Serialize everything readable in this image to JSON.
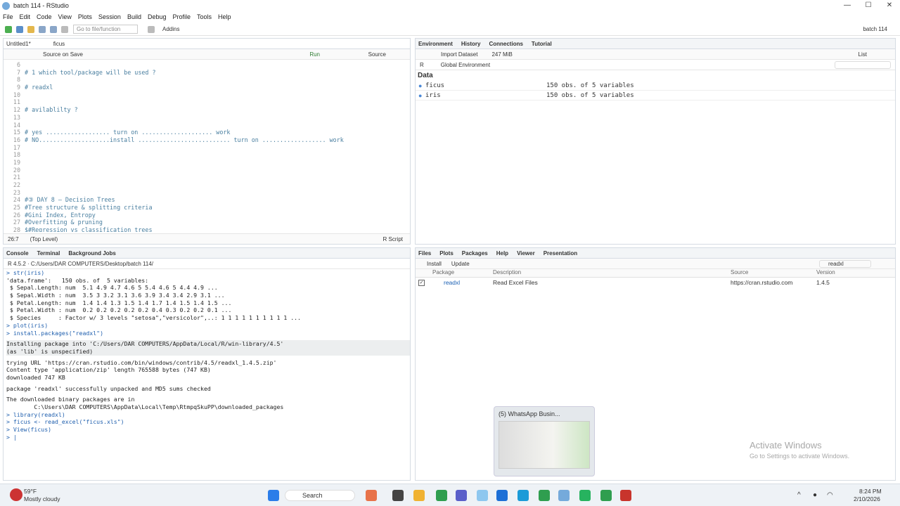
{
  "window": {
    "title": "batch 114 - RStudio",
    "controls": [
      "—",
      "☐",
      "✕"
    ]
  },
  "menu": [
    "File",
    "Edit",
    "Code",
    "View",
    "Plots",
    "Session",
    "Build",
    "Debug",
    "Profile",
    "Tools",
    "Help"
  ],
  "toolbar": {
    "goto_placeholder": "Go to file/function",
    "addins": "Addins",
    "project": "batch 114"
  },
  "editor": {
    "tabs": [
      "Untitled1*",
      "ficus"
    ],
    "source_on_save": "Source on Save",
    "run": "Run",
    "source": "Source",
    "lines": [
      {
        "n": "6",
        "t": ""
      },
      {
        "n": "7",
        "t": "# 1 which tool/package will be used ?"
      },
      {
        "n": "8",
        "t": ""
      },
      {
        "n": "9",
        "t": "# readxl"
      },
      {
        "n": "10",
        "t": ""
      },
      {
        "n": "11",
        "t": ""
      },
      {
        "n": "12",
        "t": "# avilablilty ?"
      },
      {
        "n": "13",
        "t": ""
      },
      {
        "n": "14",
        "t": ""
      },
      {
        "n": "15",
        "t": "# yes .................. turn on .................... work"
      },
      {
        "n": "16",
        "t": "# NO....................install .......................... turn on .................. work"
      },
      {
        "n": "17",
        "t": ""
      },
      {
        "n": "18",
        "t": ""
      },
      {
        "n": "19",
        "t": ""
      },
      {
        "n": "20",
        "t": ""
      },
      {
        "n": "21",
        "t": ""
      },
      {
        "n": "22",
        "t": ""
      },
      {
        "n": "23",
        "t": ""
      },
      {
        "n": "24",
        "t": "#③ DAY 8 – Decision Trees"
      },
      {
        "n": "25",
        "t": "#Tree structure & splitting criteria"
      },
      {
        "n": "26",
        "t": "#Gini Index, Entropy"
      },
      {
        "n": "27",
        "t": "#Overfitting & pruning"
      },
      {
        "n": "28",
        "t": "$#Regression vs classification trees"
      },
      {
        "n": "29",
        "t": "#Hands-on: Decision trees in R"
      }
    ],
    "status_pos": "26:7",
    "status_level": "(Top Level)",
    "status_type": "R Script"
  },
  "environment": {
    "tabs": [
      "Environment",
      "History",
      "Connections",
      "Tutorial"
    ],
    "import_dataset": "Import Dataset",
    "memory": "247 MiB",
    "list_label": "List",
    "lang": "R",
    "scope": "Global Environment",
    "section": "Data",
    "rows": [
      {
        "name": "ficus",
        "value": "150 obs. of 5 variables"
      },
      {
        "name": "iris",
        "value": "150 obs. of 5 variables"
      }
    ]
  },
  "console": {
    "tabs": [
      "Console",
      "Terminal",
      "Background Jobs"
    ],
    "path": "R 4.5.2 · C:/Users/DAR COMPUTERS/Desktop/batch 114/",
    "lines": [
      {
        "c": "cmd",
        "t": "> str(iris)"
      },
      {
        "c": "out",
        "t": "'data.frame':   150 obs. of  5 variables:"
      },
      {
        "c": "out",
        "t": " $ Sepal.Length: num  5.1 4.9 4.7 4.6 5 5.4 4.6 5 4.4 4.9 ..."
      },
      {
        "c": "out",
        "t": " $ Sepal.Width : num  3.5 3 3.2 3.1 3.6 3.9 3.4 3.4 2.9 3.1 ..."
      },
      {
        "c": "out",
        "t": " $ Petal.Length: num  1.4 1.4 1.3 1.5 1.4 1.7 1.4 1.5 1.4 1.5 ..."
      },
      {
        "c": "out",
        "t": " $ Petal.Width : num  0.2 0.2 0.2 0.2 0.2 0.4 0.3 0.2 0.2 0.1 ..."
      },
      {
        "c": "out",
        "t": " $ Species     : Factor w/ 3 levels \"setosa\",\"versicolor\",..: 1 1 1 1 1 1 1 1 1 1 ..."
      },
      {
        "c": "cmd",
        "t": "> plot(iris)"
      },
      {
        "c": "cmd",
        "t": "> install.packages(\"readxl\")"
      },
      {
        "c": "gap",
        "t": ""
      },
      {
        "c": "hl",
        "t": "Installing package into 'C:/Users/DAR COMPUTERS/AppData/Local/R/win-library/4.5'"
      },
      {
        "c": "hl",
        "t": "(as 'lib' is unspecified)"
      },
      {
        "c": "gap",
        "t": ""
      },
      {
        "c": "out",
        "t": "trying URL 'https://cran.rstudio.com/bin/windows/contrib/4.5/readxl_1.4.5.zip'"
      },
      {
        "c": "out",
        "t": "Content type 'application/zip' length 765588 bytes (747 KB)"
      },
      {
        "c": "out",
        "t": "downloaded 747 KB"
      },
      {
        "c": "gap",
        "t": ""
      },
      {
        "c": "out",
        "t": "package 'readxl' successfully unpacked and MD5 sums checked"
      },
      {
        "c": "gap",
        "t": ""
      },
      {
        "c": "out",
        "t": "The downloaded binary packages are in"
      },
      {
        "c": "out",
        "t": "        C:\\Users\\DAR COMPUTERS\\AppData\\Local\\Temp\\RtmpqSkuPP\\downloaded_packages"
      },
      {
        "c": "cmd",
        "t": "> library(readxl)"
      },
      {
        "c": "cmd",
        "t": "> ficus <- read_excel(\"ficus.xls\")"
      },
      {
        "c": "cmd",
        "t": "> View(ficus)"
      },
      {
        "c": "cmd",
        "t": "> |"
      }
    ]
  },
  "files": {
    "tabs": [
      "Files",
      "Plots",
      "Packages",
      "Help",
      "Viewer",
      "Presentation"
    ],
    "install": "Install",
    "update": "Update",
    "search_value": "readxl",
    "columns": [
      "Package",
      "Description",
      "Source",
      "Version"
    ],
    "rows": [
      {
        "pkg": "readxl",
        "desc": "Read Excel Files",
        "src": "https://cran.rstudio.com",
        "ver": "1.4.5"
      }
    ]
  },
  "popup": {
    "title": "(5) WhatsApp Busin..."
  },
  "activate": {
    "line1": "Activate Windows",
    "line2": "Go to Settings to activate Windows."
  },
  "taskbar": {
    "temp": "59°F",
    "weather": "Mostly cloudy",
    "search": "Search",
    "time": "8:24 PM",
    "date": "2/10/2026"
  }
}
